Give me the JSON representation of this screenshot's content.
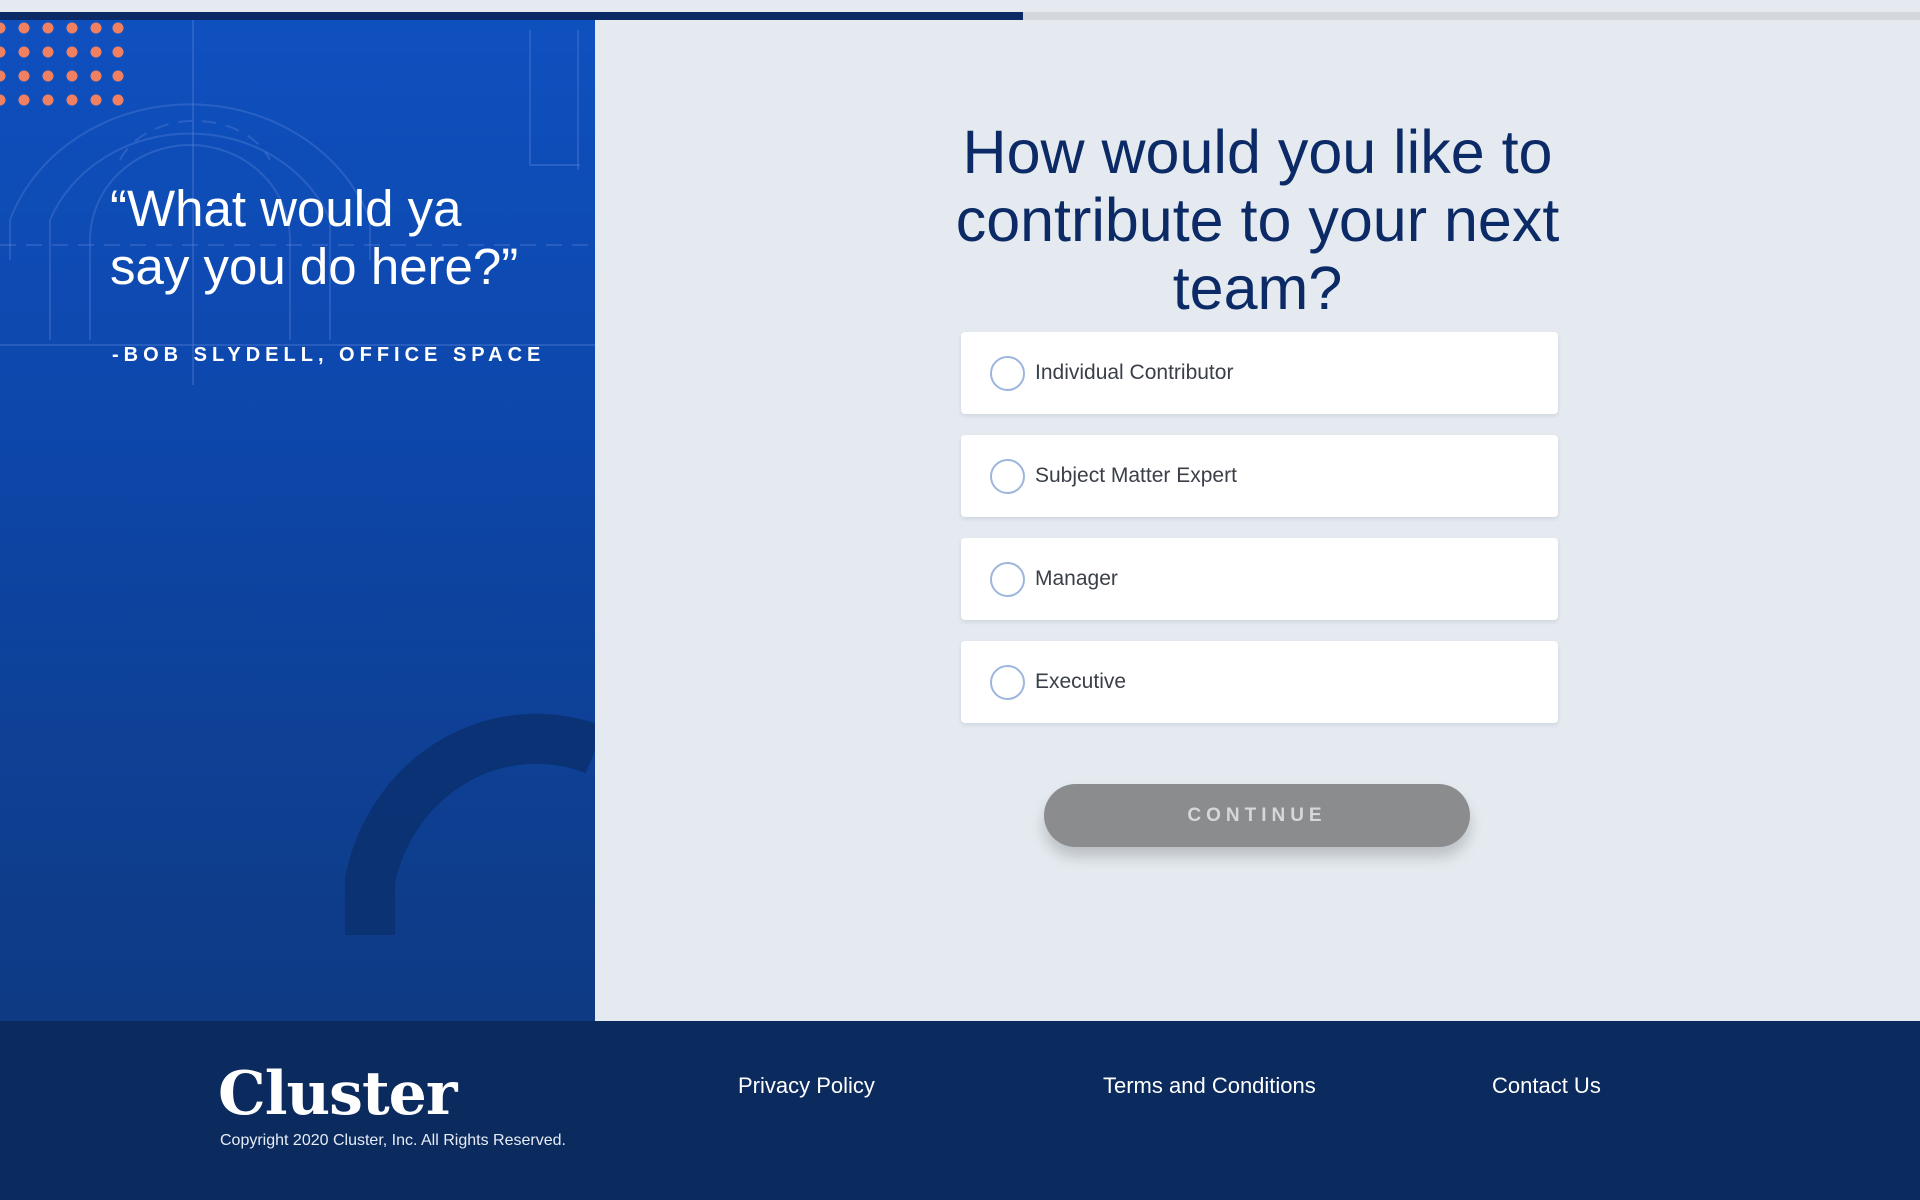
{
  "progress": {
    "fraction": 0.533
  },
  "quote_panel": {
    "quote": "“What would ya say you do here?”",
    "attribution": "-BOB SLYDELL, OFFICE SPACE"
  },
  "question": {
    "heading": "How would you like to contribute to your next team?",
    "options": [
      {
        "label": "Individual Contributor",
        "selected": false
      },
      {
        "label": "Subject Matter Expert",
        "selected": false
      },
      {
        "label": "Manager",
        "selected": false
      },
      {
        "label": "Executive",
        "selected": false
      }
    ],
    "continue_label": "CONTINUE"
  },
  "footer": {
    "logo": "Cluster",
    "copyright": "Copyright 2020 Cluster, Inc. All Rights Reserved.",
    "links": {
      "privacy": "Privacy Policy",
      "terms": "Terms and Conditions",
      "contact": "Contact Us"
    }
  },
  "colors": {
    "navy": "#0b2a66",
    "brand_blue": "#0f50bf",
    "dot_orange": "#f08060",
    "button_disabled": "#8b8c8e",
    "radio_border": "#9cb6dd"
  }
}
